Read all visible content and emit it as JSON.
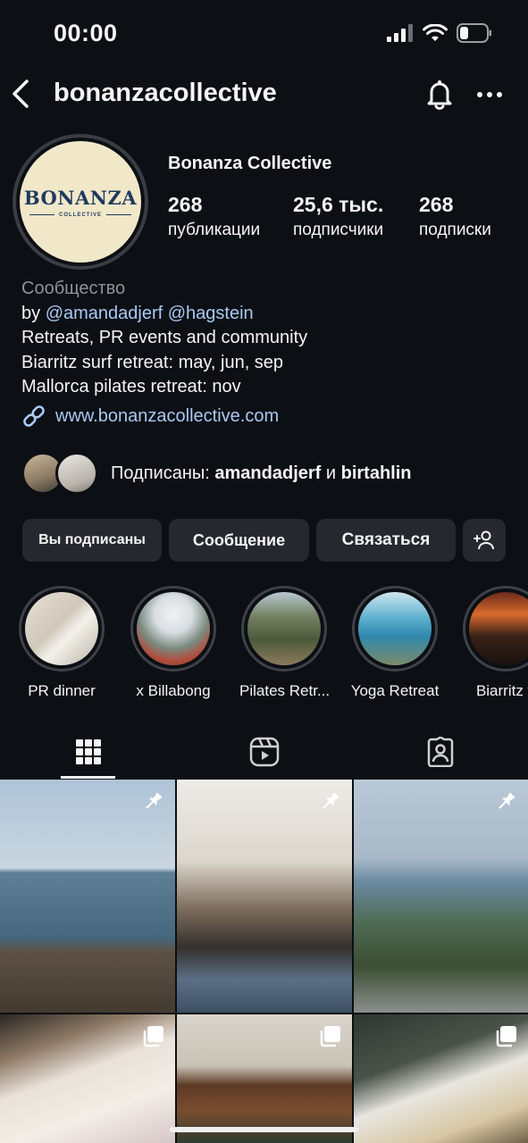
{
  "status_bar": {
    "time": "00:00"
  },
  "header": {
    "username": "bonanzacollective"
  },
  "profile": {
    "display_name": "Bonanza Collective",
    "avatar_logo_text": "BONANZA",
    "avatar_logo_sub": "COLLECTIVE",
    "stats": [
      {
        "value": "268",
        "label": "публикации"
      },
      {
        "value": "25,6 тыс.",
        "label": "подписчики"
      },
      {
        "value": "268",
        "label": "подписки"
      }
    ]
  },
  "bio": {
    "category": "Сообщество",
    "by_prefix": "by ",
    "mentions": [
      "@amandadjerf",
      "@hagstein"
    ],
    "lines": [
      "Retreats, PR events and community",
      "Biarritz surf retreat: may, jun, sep",
      "Mallorca pilates retreat: nov"
    ],
    "link": "www.bonanzacollective.com"
  },
  "followed_by": {
    "prefix": "Подписаны: ",
    "user1": "amandadjerf",
    "joiner": " и ",
    "user2": "birtahlin"
  },
  "actions": {
    "following": "Вы подписаны",
    "message": "Сообщение",
    "contact": "Связаться"
  },
  "highlights": [
    {
      "label": "PR dinner"
    },
    {
      "label": "x Billabong"
    },
    {
      "label": "Pilates Retr..."
    },
    {
      "label": "Yoga Retreat"
    },
    {
      "label": "Biarritz v"
    }
  ],
  "tabs": [
    "grid",
    "reels",
    "tagged"
  ],
  "grid_posts": [
    {
      "kind": "pinned"
    },
    {
      "kind": "pinned"
    },
    {
      "kind": "pinned"
    },
    {
      "kind": "carousel"
    },
    {
      "kind": "carousel"
    },
    {
      "kind": "carousel"
    }
  ],
  "colors": {
    "background": "#0c0f14",
    "link": "#a9c9f3",
    "button": "#25292f",
    "muted": "#8e9199"
  }
}
